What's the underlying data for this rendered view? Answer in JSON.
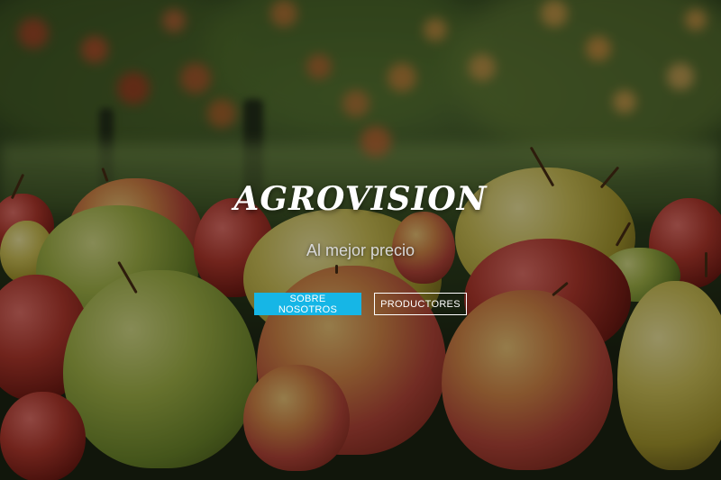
{
  "hero": {
    "brand_title": "AGROVISION",
    "tagline": "Al mejor precio",
    "buttons": {
      "about_label": "SOBRE NOSOTROS",
      "producers_label": "PRODUCTORES"
    }
  },
  "colors": {
    "primary_button": "#16b6e6",
    "outline_button_border": "#ffffff",
    "text": "#ffffff"
  }
}
